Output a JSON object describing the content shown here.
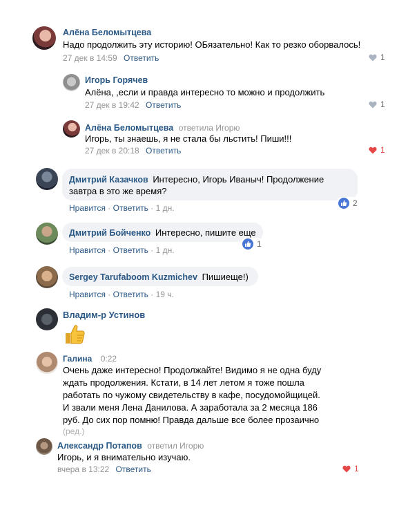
{
  "colors": {
    "link": "#2a5885",
    "meta": "#939393",
    "heart_liked": "#e64646",
    "heart_empty": "#aab4c0",
    "fb_like": "#4a76d6",
    "bubble": "#f0f2f5"
  },
  "vk": [
    {
      "author": "Алёна Беломытцева",
      "text": "Надо продолжить эту историю! ОБязательно! Как то резко оборвалось!",
      "date": "27 дек в 14:59",
      "reply": "Ответить",
      "likes": "1",
      "liked": false
    },
    {
      "author": "Игорь Горячев",
      "text": "Алёна, ,если и правда интересно то можно и продолжить",
      "date": "27 дек в 19:42",
      "reply": "Ответить",
      "likes": "1",
      "liked": false
    },
    {
      "author": "Алёна Беломытцева",
      "answered": "ответила Игорю",
      "text": "Игорь, ты знаешь, я не стала бы льстить! Пиши!!!",
      "date": "27 дек в 20:18",
      "reply": "Ответить",
      "likes": "1",
      "liked": true
    }
  ],
  "fb": [
    {
      "author": "Дмитрий Казачков",
      "text_line1": "Интересно, Игорь Иваныч! Продолжение",
      "text_line2": "завтра в это же время?",
      "like": "Нравится",
      "reply": "Ответить",
      "time": "1 дн.",
      "count": "2"
    },
    {
      "author": "Дмитрий Бойченко",
      "text": "Интересно, пишите еще",
      "like": "Нравится",
      "reply": "Ответить",
      "time": "1 дн.",
      "count": "1"
    },
    {
      "author": "Sergey Tarufaboom Kuzmichev",
      "text": "Пишиеще!)",
      "like": "Нравится",
      "reply": "Ответить",
      "time": "19 ч."
    }
  ],
  "ok": [
    {
      "author": "Владим-р Устинов",
      "sticker": "thumbs-up"
    },
    {
      "author": "Галина",
      "time": "0:22",
      "lines": [
        "Очень даже интересно! Продолжайте! Видимо я не одна буду",
        "ждать продолжения. Кстати, в 14 лет летом я тоже пошла",
        "работать по чужому свидетельству в кафе, посудомойщицей.",
        "И звали меня Лена Данилова. А заработала за 2 месяца 186",
        "руб. До сих пор помню! Правда дальше все более прозаично"
      ],
      "edited": "(ред.)"
    }
  ],
  "vk2": {
    "author": "Александр Потапов",
    "answered": "ответил Игорю",
    "text": "Игорь, и я внимательно изучаю.",
    "date": "вчера в 13:22",
    "reply": "Ответить",
    "likes": "1",
    "liked": true
  }
}
